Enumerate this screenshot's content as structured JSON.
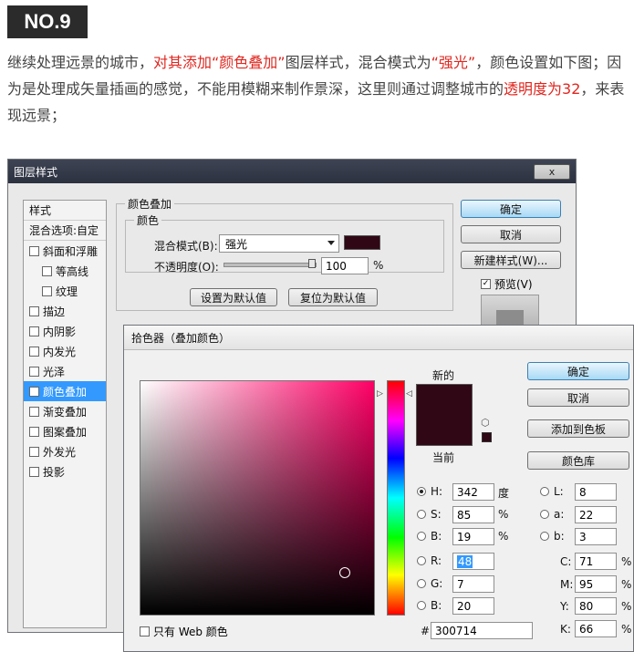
{
  "badge": "NO.9",
  "article": {
    "p1": "继续处理远景的城市，",
    "p2": "对其添加“颜色叠加”",
    "p3": "图层样式，混合模式为",
    "p4": "“强光”",
    "p5": "，颜色设置如下图；因为是处理成矢量插画的感觉，不能用模糊来制作景深，这里则通过调整城市的",
    "p6": "透明度为32",
    "p7": "，来表现远景；"
  },
  "layer_style": {
    "title": "图层样式",
    "close": "x",
    "styles_header": "样式",
    "blend_options": "混合选项:自定",
    "items": [
      "斜面和浮雕",
      "等高线",
      "纹理",
      "描边",
      "内阴影",
      "内发光",
      "光泽",
      "颜色叠加",
      "渐变叠加",
      "图案叠加",
      "外发光",
      "投影"
    ],
    "section": "颜色叠加",
    "subsection": "颜色",
    "blend_mode_label": "混合模式(B):",
    "blend_mode_value": "强光",
    "opacity_label": "不透明度(O):",
    "opacity_value": "100",
    "percent": "%",
    "set_default": "设置为默认值",
    "reset_default": "复位为默认值",
    "ok": "确定",
    "cancel": "取消",
    "new_style": "新建样式(W)...",
    "preview": "预览(V)",
    "overlay_color": "#300714"
  },
  "picker": {
    "title": "拾色器（叠加颜色）",
    "new": "新的",
    "current": "当前",
    "ok": "确定",
    "cancel": "取消",
    "add_swatch": "添加到色板",
    "libraries": "颜色库",
    "web_only": "只有 Web 颜色",
    "H": {
      "label": "H:",
      "value": "342",
      "unit": "度"
    },
    "S": {
      "label": "S:",
      "value": "85",
      "unit": "%"
    },
    "Bv": {
      "label": "B:",
      "value": "19",
      "unit": "%"
    },
    "R": {
      "label": "R:",
      "value": "48"
    },
    "G": {
      "label": "G:",
      "value": "7"
    },
    "Bc": {
      "label": "B:",
      "value": "20"
    },
    "L": {
      "label": "L:",
      "value": "8"
    },
    "a": {
      "label": "a:",
      "value": "22"
    },
    "b": {
      "label": "b:",
      "value": "3"
    },
    "C": {
      "label": "C:",
      "value": "71",
      "unit": "%"
    },
    "M": {
      "label": "M:",
      "value": "95",
      "unit": "%"
    },
    "Y": {
      "label": "Y:",
      "value": "80",
      "unit": "%"
    },
    "K": {
      "label": "K:",
      "value": "66",
      "unit": "%"
    },
    "hash": "#",
    "hex": "300714",
    "color": "#300714"
  }
}
